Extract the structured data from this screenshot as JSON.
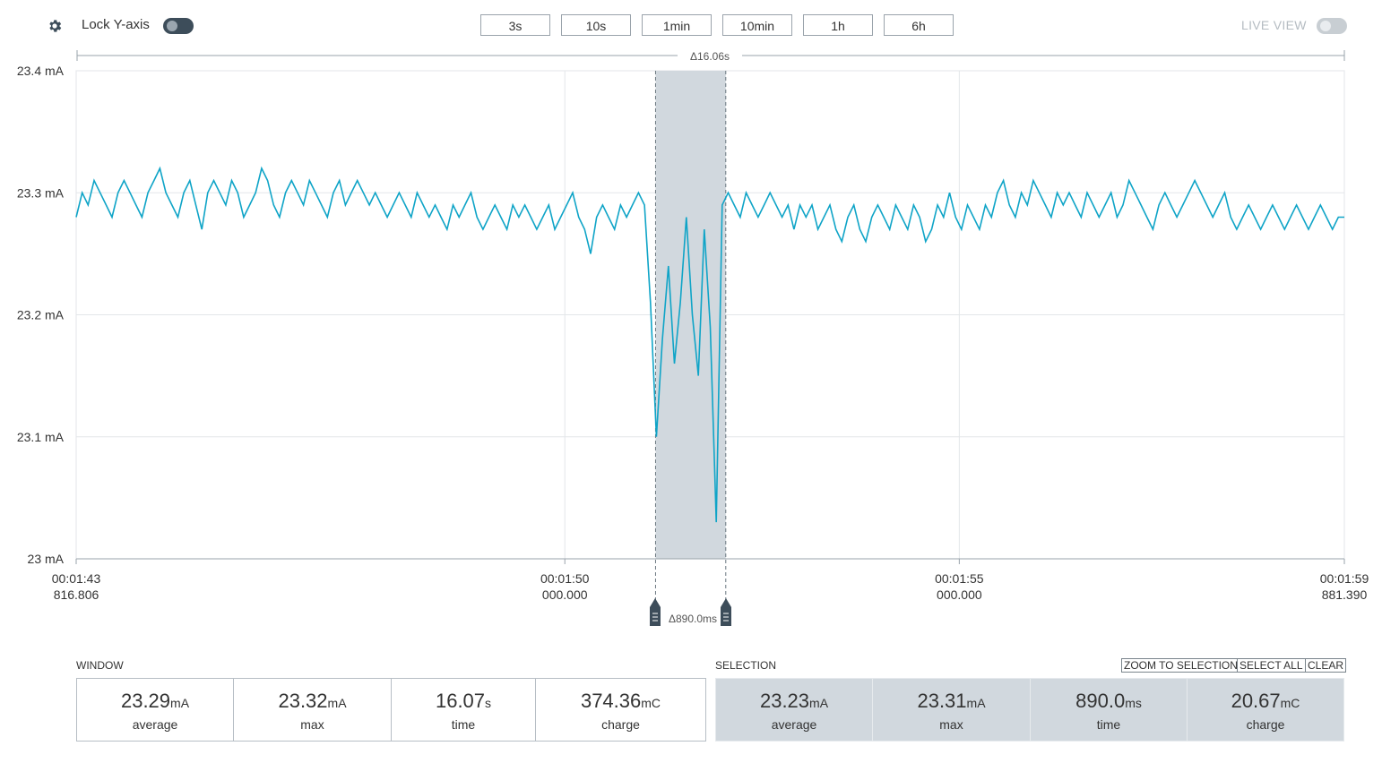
{
  "toolbar": {
    "lock_label": "Lock Y-axis",
    "lock_on": true,
    "zoom_buttons": [
      "3s",
      "10s",
      "1min",
      "10min",
      "1h",
      "6h"
    ],
    "live_label": "LIVE VIEW",
    "live_on": false
  },
  "window_span": "Δ16.06s",
  "cursor_span": "Δ890.0ms",
  "y_ticks": [
    "23.4 mA",
    "23.3 mA",
    "23.2 mA",
    "23.1 mA",
    "23 mA"
  ],
  "x_ticks": [
    {
      "l1": "00:01:43",
      "l2": "816.806"
    },
    {
      "l1": "00:01:50",
      "l2": "000.000"
    },
    {
      "l1": "00:01:55",
      "l2": "000.000"
    },
    {
      "l1": "00:01:59",
      "l2": "881.390"
    }
  ],
  "colors": {
    "trace": "#0fa4c7",
    "selection": "#d1d8de",
    "dark": "#3d4d5a"
  },
  "chart_data": {
    "type": "line",
    "ylim": [
      23.0,
      23.4
    ],
    "ylabel_unit": "mA",
    "x_range_s": [
      103.806,
      119.881
    ],
    "selection_s": [
      111.15,
      112.04
    ],
    "series": [
      {
        "values": [
          23.28,
          23.3,
          23.29,
          23.31,
          23.3,
          23.29,
          23.28,
          23.3,
          23.31,
          23.3,
          23.29,
          23.28,
          23.3,
          23.31,
          23.32,
          23.3,
          23.29,
          23.28,
          23.3,
          23.31,
          23.29,
          23.27,
          23.3,
          23.31,
          23.3,
          23.29,
          23.31,
          23.3,
          23.28,
          23.29,
          23.3,
          23.32,
          23.31,
          23.29,
          23.28,
          23.3,
          23.31,
          23.3,
          23.29,
          23.31,
          23.3,
          23.29,
          23.28,
          23.3,
          23.31,
          23.29,
          23.3,
          23.31,
          23.3,
          23.29,
          23.3,
          23.29,
          23.28,
          23.29,
          23.3,
          23.29,
          23.28,
          23.3,
          23.29,
          23.28,
          23.29,
          23.28,
          23.27,
          23.29,
          23.28,
          23.29,
          23.3,
          23.28,
          23.27,
          23.28,
          23.29,
          23.28,
          23.27,
          23.29,
          23.28,
          23.29,
          23.28,
          23.27,
          23.28,
          23.29,
          23.27,
          23.28,
          23.29,
          23.3,
          23.28,
          23.27,
          23.25,
          23.28,
          23.29,
          23.28,
          23.27,
          23.29,
          23.28,
          23.29,
          23.3,
          23.29,
          23.21,
          23.1,
          23.18,
          23.24,
          23.16,
          23.21,
          23.28,
          23.2,
          23.15,
          23.27,
          23.19,
          23.03,
          23.29,
          23.3,
          23.29,
          23.28,
          23.3,
          23.29,
          23.28,
          23.29,
          23.3,
          23.29,
          23.28,
          23.29,
          23.27,
          23.29,
          23.28,
          23.29,
          23.27,
          23.28,
          23.29,
          23.27,
          23.26,
          23.28,
          23.29,
          23.27,
          23.26,
          23.28,
          23.29,
          23.28,
          23.27,
          23.29,
          23.28,
          23.27,
          23.29,
          23.28,
          23.26,
          23.27,
          23.29,
          23.28,
          23.3,
          23.28,
          23.27,
          23.29,
          23.28,
          23.27,
          23.29,
          23.28,
          23.3,
          23.31,
          23.29,
          23.28,
          23.3,
          23.29,
          23.31,
          23.3,
          23.29,
          23.28,
          23.3,
          23.29,
          23.3,
          23.29,
          23.28,
          23.3,
          23.29,
          23.28,
          23.29,
          23.3,
          23.28,
          23.29,
          23.31,
          23.3,
          23.29,
          23.28,
          23.27,
          23.29,
          23.3,
          23.29,
          23.28,
          23.29,
          23.3,
          23.31,
          23.3,
          23.29,
          23.28,
          23.29,
          23.3,
          23.28,
          23.27,
          23.28,
          23.29,
          23.28,
          23.27,
          23.28,
          23.29,
          23.28,
          23.27,
          23.28,
          23.29,
          23.28,
          23.27,
          23.28,
          23.29,
          23.28,
          23.27,
          23.28,
          23.28
        ]
      }
    ]
  },
  "window": {
    "title": "WINDOW",
    "stats": [
      {
        "value": "23.29",
        "unit": "mA",
        "label": "average"
      },
      {
        "value": "23.32",
        "unit": "mA",
        "label": "max"
      },
      {
        "value": "16.07",
        "unit": "s",
        "label": "time"
      },
      {
        "value": "374.36",
        "unit": "mC",
        "label": "charge"
      }
    ]
  },
  "selection": {
    "title": "SELECTION",
    "actions": [
      "ZOOM TO SELECTION",
      "SELECT ALL",
      "CLEAR"
    ],
    "stats": [
      {
        "value": "23.23",
        "unit": "mA",
        "label": "average"
      },
      {
        "value": "23.31",
        "unit": "mA",
        "label": "max"
      },
      {
        "value": "890.0",
        "unit": "ms",
        "label": "time"
      },
      {
        "value": "20.67",
        "unit": "mC",
        "label": "charge"
      }
    ]
  }
}
